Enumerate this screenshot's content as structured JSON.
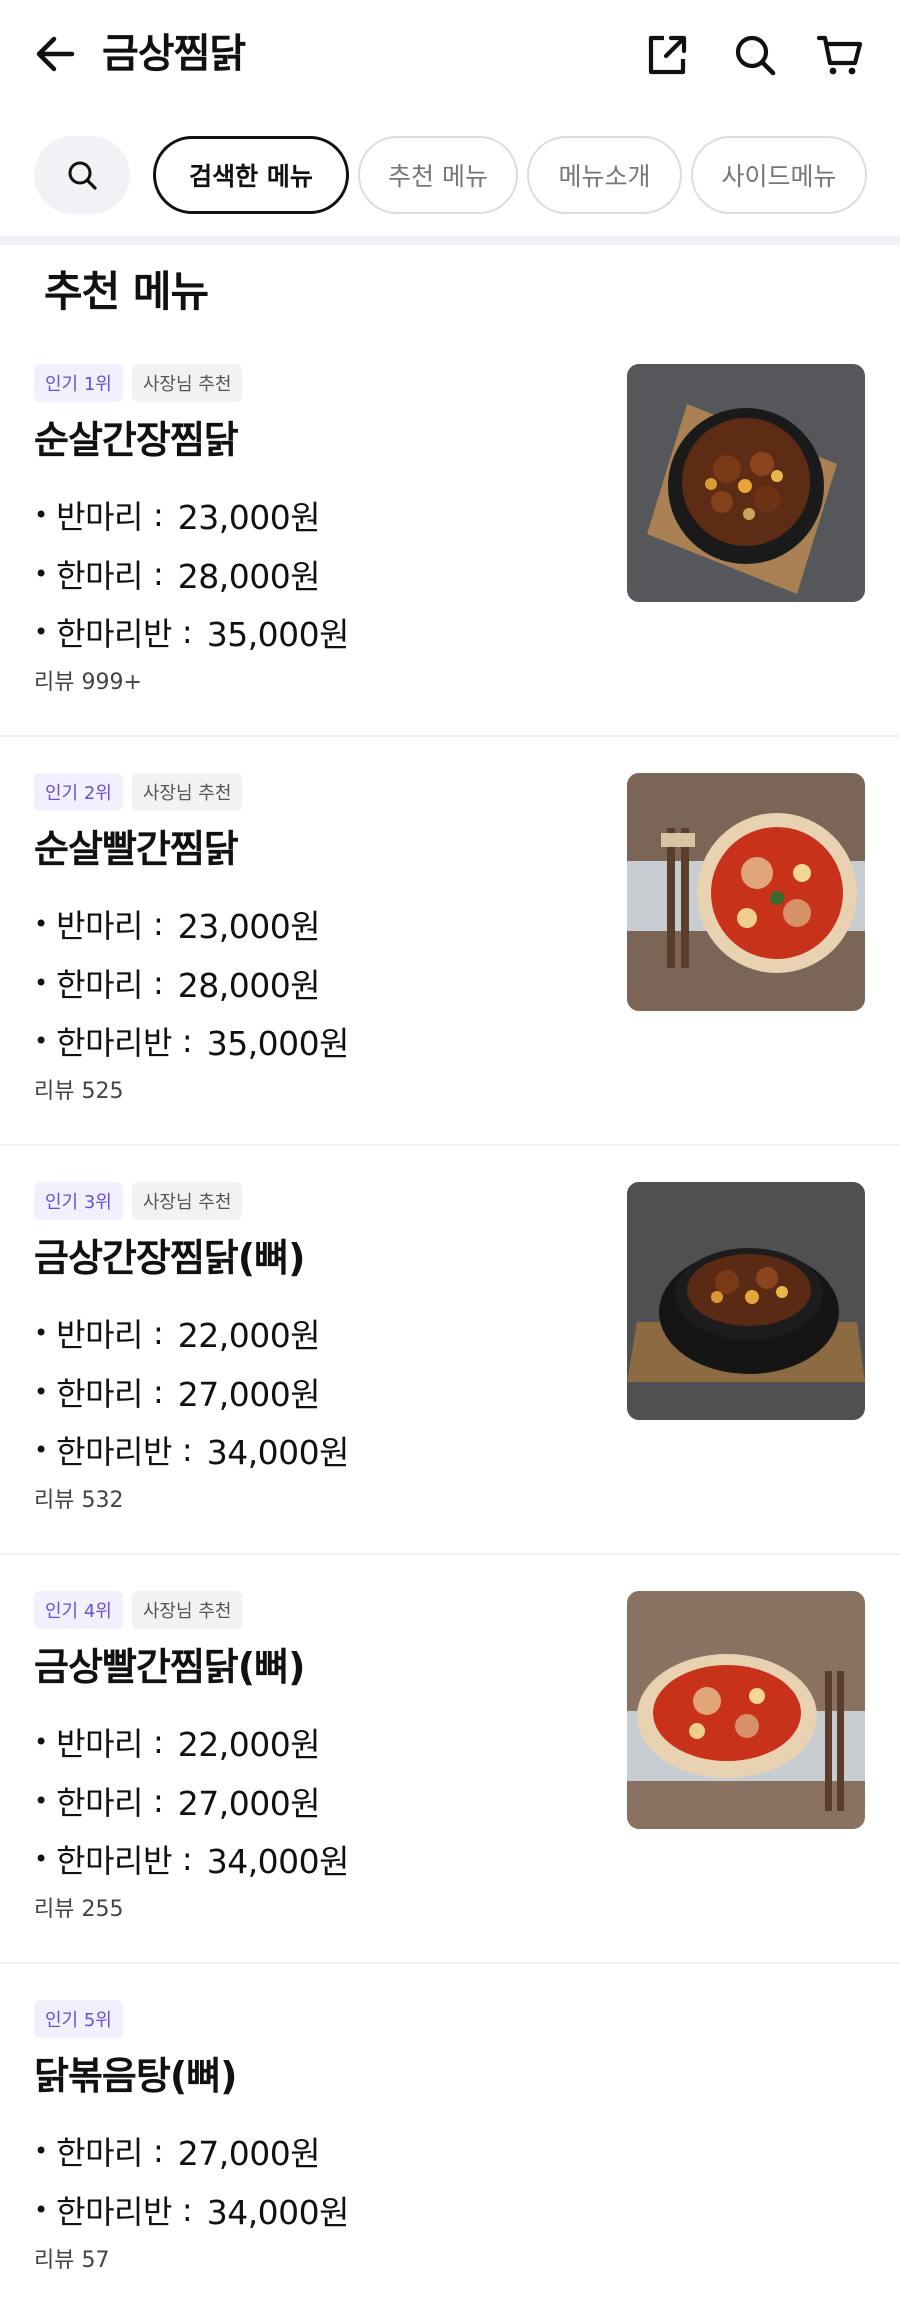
{
  "header": {
    "title": "금상찜닭",
    "back_icon": "arrow-left-icon",
    "share_icon": "share-icon",
    "search_icon": "search-icon",
    "cart_icon": "cart-icon"
  },
  "tabs": [
    {
      "label": "검색한 메뉴",
      "active": true
    },
    {
      "label": "추천 메뉴",
      "active": false
    },
    {
      "label": "메뉴소개",
      "active": false
    },
    {
      "label": "사이드메뉴",
      "active": false
    }
  ],
  "section": {
    "title": "추천 메뉴"
  },
  "items": [
    {
      "rank": "인기 1위",
      "owner_pick": "사장님 추천",
      "name": "순살간장찜닭",
      "prices": [
        {
          "size": "반마리",
          "amount": "23,000원"
        },
        {
          "size": "한마리",
          "amount": "28,000원"
        },
        {
          "size": "한마리반",
          "amount": "35,000원"
        }
      ],
      "review": "리뷰 999+"
    },
    {
      "rank": "인기 2위",
      "owner_pick": "사장님 추천",
      "name": "순살빨간찜닭",
      "prices": [
        {
          "size": "반마리",
          "amount": "23,000원"
        },
        {
          "size": "한마리",
          "amount": "28,000원"
        },
        {
          "size": "한마리반",
          "amount": "35,000원"
        }
      ],
      "review": "리뷰 525"
    },
    {
      "rank": "인기 3위",
      "owner_pick": "사장님 추천",
      "name": "금상간장찜닭(뼈)",
      "prices": [
        {
          "size": "반마리",
          "amount": "22,000원"
        },
        {
          "size": "한마리",
          "amount": "27,000원"
        },
        {
          "size": "한마리반",
          "amount": "34,000원"
        }
      ],
      "review": "리뷰 532"
    },
    {
      "rank": "인기 4위",
      "owner_pick": "사장님 추천",
      "name": "금상빨간찜닭(뼈)",
      "prices": [
        {
          "size": "반마리",
          "amount": "22,000원"
        },
        {
          "size": "한마리",
          "amount": "27,000원"
        },
        {
          "size": "한마리반",
          "amount": "34,000원"
        }
      ],
      "review": "리뷰 255"
    },
    {
      "rank": "인기 5위",
      "name": "닭볶음탕(뼈)",
      "prices": [
        {
          "size": "한마리",
          "amount": "27,000원"
        },
        {
          "size": "한마리반",
          "amount": "34,000원"
        }
      ],
      "review": "리뷰 57"
    }
  ],
  "colors": {
    "accent_purple": "#6a4fd6",
    "rank_badge_bg": "#f2f0fc",
    "owner_badge_bg": "#f2f2f4",
    "divider": "#eef0f6"
  }
}
